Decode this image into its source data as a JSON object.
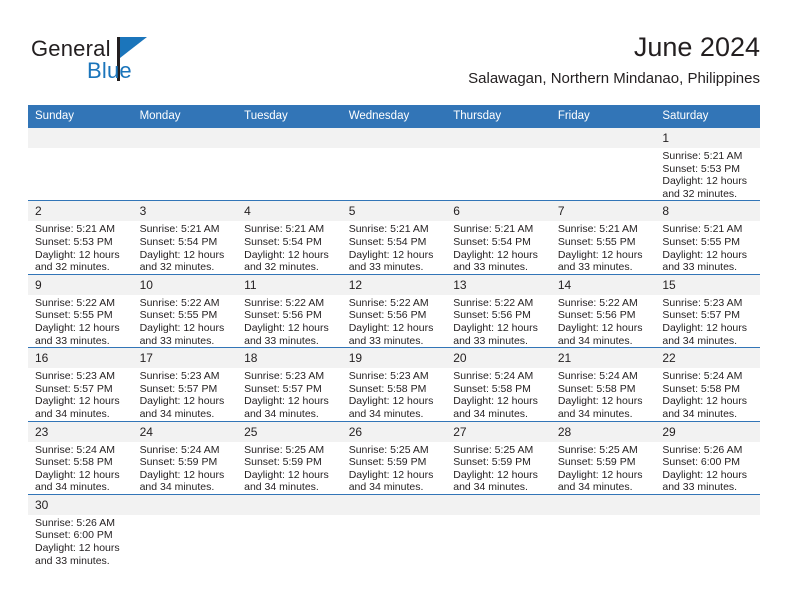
{
  "brand": {
    "name_top": "General",
    "name_bottom": "Blue",
    "accent_color": "#1b75bb"
  },
  "header": {
    "title": "June 2024",
    "location": "Salawagan, Northern Mindanao, Philippines"
  },
  "theme": {
    "header_bg": "#3275b7",
    "header_text": "#ffffff",
    "daynum_bg": "#f2f2f2",
    "rule_color": "#3275b7",
    "body_text": "#231f20"
  },
  "weekday_headers": [
    "Sunday",
    "Monday",
    "Tuesday",
    "Wednesday",
    "Thursday",
    "Friday",
    "Saturday"
  ],
  "weeks": [
    [
      {
        "day": "",
        "empty": true
      },
      {
        "day": "",
        "empty": true
      },
      {
        "day": "",
        "empty": true
      },
      {
        "day": "",
        "empty": true
      },
      {
        "day": "",
        "empty": true
      },
      {
        "day": "",
        "empty": true
      },
      {
        "day": "1",
        "sunrise": "Sunrise: 5:21 AM",
        "sunset": "Sunset: 5:53 PM",
        "daylight": "Daylight: 12 hours and 32 minutes."
      }
    ],
    [
      {
        "day": "2",
        "sunrise": "Sunrise: 5:21 AM",
        "sunset": "Sunset: 5:53 PM",
        "daylight": "Daylight: 12 hours and 32 minutes."
      },
      {
        "day": "3",
        "sunrise": "Sunrise: 5:21 AM",
        "sunset": "Sunset: 5:54 PM",
        "daylight": "Daylight: 12 hours and 32 minutes."
      },
      {
        "day": "4",
        "sunrise": "Sunrise: 5:21 AM",
        "sunset": "Sunset: 5:54 PM",
        "daylight": "Daylight: 12 hours and 32 minutes."
      },
      {
        "day": "5",
        "sunrise": "Sunrise: 5:21 AM",
        "sunset": "Sunset: 5:54 PM",
        "daylight": "Daylight: 12 hours and 33 minutes."
      },
      {
        "day": "6",
        "sunrise": "Sunrise: 5:21 AM",
        "sunset": "Sunset: 5:54 PM",
        "daylight": "Daylight: 12 hours and 33 minutes."
      },
      {
        "day": "7",
        "sunrise": "Sunrise: 5:21 AM",
        "sunset": "Sunset: 5:55 PM",
        "daylight": "Daylight: 12 hours and 33 minutes."
      },
      {
        "day": "8",
        "sunrise": "Sunrise: 5:21 AM",
        "sunset": "Sunset: 5:55 PM",
        "daylight": "Daylight: 12 hours and 33 minutes."
      }
    ],
    [
      {
        "day": "9",
        "sunrise": "Sunrise: 5:22 AM",
        "sunset": "Sunset: 5:55 PM",
        "daylight": "Daylight: 12 hours and 33 minutes."
      },
      {
        "day": "10",
        "sunrise": "Sunrise: 5:22 AM",
        "sunset": "Sunset: 5:55 PM",
        "daylight": "Daylight: 12 hours and 33 minutes."
      },
      {
        "day": "11",
        "sunrise": "Sunrise: 5:22 AM",
        "sunset": "Sunset: 5:56 PM",
        "daylight": "Daylight: 12 hours and 33 minutes."
      },
      {
        "day": "12",
        "sunrise": "Sunrise: 5:22 AM",
        "sunset": "Sunset: 5:56 PM",
        "daylight": "Daylight: 12 hours and 33 minutes."
      },
      {
        "day": "13",
        "sunrise": "Sunrise: 5:22 AM",
        "sunset": "Sunset: 5:56 PM",
        "daylight": "Daylight: 12 hours and 33 minutes."
      },
      {
        "day": "14",
        "sunrise": "Sunrise: 5:22 AM",
        "sunset": "Sunset: 5:56 PM",
        "daylight": "Daylight: 12 hours and 34 minutes."
      },
      {
        "day": "15",
        "sunrise": "Sunrise: 5:23 AM",
        "sunset": "Sunset: 5:57 PM",
        "daylight": "Daylight: 12 hours and 34 minutes."
      }
    ],
    [
      {
        "day": "16",
        "sunrise": "Sunrise: 5:23 AM",
        "sunset": "Sunset: 5:57 PM",
        "daylight": "Daylight: 12 hours and 34 minutes."
      },
      {
        "day": "17",
        "sunrise": "Sunrise: 5:23 AM",
        "sunset": "Sunset: 5:57 PM",
        "daylight": "Daylight: 12 hours and 34 minutes."
      },
      {
        "day": "18",
        "sunrise": "Sunrise: 5:23 AM",
        "sunset": "Sunset: 5:57 PM",
        "daylight": "Daylight: 12 hours and 34 minutes."
      },
      {
        "day": "19",
        "sunrise": "Sunrise: 5:23 AM",
        "sunset": "Sunset: 5:58 PM",
        "daylight": "Daylight: 12 hours and 34 minutes."
      },
      {
        "day": "20",
        "sunrise": "Sunrise: 5:24 AM",
        "sunset": "Sunset: 5:58 PM",
        "daylight": "Daylight: 12 hours and 34 minutes."
      },
      {
        "day": "21",
        "sunrise": "Sunrise: 5:24 AM",
        "sunset": "Sunset: 5:58 PM",
        "daylight": "Daylight: 12 hours and 34 minutes."
      },
      {
        "day": "22",
        "sunrise": "Sunrise: 5:24 AM",
        "sunset": "Sunset: 5:58 PM",
        "daylight": "Daylight: 12 hours and 34 minutes."
      }
    ],
    [
      {
        "day": "23",
        "sunrise": "Sunrise: 5:24 AM",
        "sunset": "Sunset: 5:58 PM",
        "daylight": "Daylight: 12 hours and 34 minutes."
      },
      {
        "day": "24",
        "sunrise": "Sunrise: 5:24 AM",
        "sunset": "Sunset: 5:59 PM",
        "daylight": "Daylight: 12 hours and 34 minutes."
      },
      {
        "day": "25",
        "sunrise": "Sunrise: 5:25 AM",
        "sunset": "Sunset: 5:59 PM",
        "daylight": "Daylight: 12 hours and 34 minutes."
      },
      {
        "day": "26",
        "sunrise": "Sunrise: 5:25 AM",
        "sunset": "Sunset: 5:59 PM",
        "daylight": "Daylight: 12 hours and 34 minutes."
      },
      {
        "day": "27",
        "sunrise": "Sunrise: 5:25 AM",
        "sunset": "Sunset: 5:59 PM",
        "daylight": "Daylight: 12 hours and 34 minutes."
      },
      {
        "day": "28",
        "sunrise": "Sunrise: 5:25 AM",
        "sunset": "Sunset: 5:59 PM",
        "daylight": "Daylight: 12 hours and 34 minutes."
      },
      {
        "day": "29",
        "sunrise": "Sunrise: 5:26 AM",
        "sunset": "Sunset: 6:00 PM",
        "daylight": "Daylight: 12 hours and 33 minutes."
      }
    ],
    [
      {
        "day": "30",
        "sunrise": "Sunrise: 5:26 AM",
        "sunset": "Sunset: 6:00 PM",
        "daylight": "Daylight: 12 hours and 33 minutes."
      },
      {
        "day": "",
        "empty": true
      },
      {
        "day": "",
        "empty": true
      },
      {
        "day": "",
        "empty": true
      },
      {
        "day": "",
        "empty": true
      },
      {
        "day": "",
        "empty": true
      },
      {
        "day": "",
        "empty": true
      }
    ]
  ]
}
